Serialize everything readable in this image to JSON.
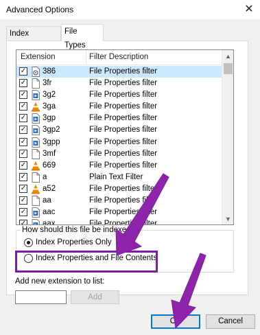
{
  "window": {
    "title": "Advanced Options"
  },
  "tabs": [
    {
      "label": "Index Settings",
      "selected": false
    },
    {
      "label": "File Types",
      "selected": true
    }
  ],
  "file_list": {
    "columns": [
      "Extension",
      "Filter Description"
    ],
    "rows": [
      {
        "checked": true,
        "icon": "settings-file-icon",
        "ext": "386",
        "desc": "File Properties filter",
        "selected": true
      },
      {
        "checked": true,
        "icon": "blank-file-icon",
        "ext": "3fr",
        "desc": "File Properties filter",
        "selected": false
      },
      {
        "checked": true,
        "icon": "media-file-icon",
        "ext": "3g2",
        "desc": "File Properties filter",
        "selected": false
      },
      {
        "checked": true,
        "icon": "vlc-cone-icon",
        "ext": "3ga",
        "desc": "File Properties filter",
        "selected": false
      },
      {
        "checked": true,
        "icon": "media-file-icon",
        "ext": "3gp",
        "desc": "File Properties filter",
        "selected": false
      },
      {
        "checked": true,
        "icon": "media-file-icon",
        "ext": "3gp2",
        "desc": "File Properties filter",
        "selected": false
      },
      {
        "checked": true,
        "icon": "media-file-icon",
        "ext": "3gpp",
        "desc": "File Properties filter",
        "selected": false
      },
      {
        "checked": true,
        "icon": "blank-file-icon",
        "ext": "3mf",
        "desc": "File Properties filter",
        "selected": false
      },
      {
        "checked": true,
        "icon": "vlc-cone-icon",
        "ext": "669",
        "desc": "File Properties filter",
        "selected": false
      },
      {
        "checked": true,
        "icon": "blank-file-icon",
        "ext": "a",
        "desc": "Plain Text Filter",
        "selected": false
      },
      {
        "checked": true,
        "icon": "vlc-cone-icon",
        "ext": "a52",
        "desc": "File Properties filter",
        "selected": false
      },
      {
        "checked": true,
        "icon": "blank-file-icon",
        "ext": "aa",
        "desc": "File Properties filter",
        "selected": false
      },
      {
        "checked": true,
        "icon": "media-file-icon",
        "ext": "aac",
        "desc": "File Properties filter",
        "selected": false
      },
      {
        "checked": true,
        "icon": "media-file-icon",
        "ext": "aax",
        "desc": "File Properties filter",
        "selected": false
      }
    ]
  },
  "index_mode": {
    "legend": "How should this file be indexed?",
    "options": [
      {
        "label": "Index Properties Only",
        "selected": true
      },
      {
        "label": "Index Properties and File Contents",
        "selected": false
      }
    ]
  },
  "add_extension": {
    "label": "Add new extension to list:",
    "value": "",
    "button": "Add"
  },
  "buttons": {
    "ok": "OK",
    "cancel": "Cancel"
  },
  "colors": {
    "annotation": "#7b1fa2",
    "selection": "#cce8ff",
    "focus": "#0078d7"
  }
}
